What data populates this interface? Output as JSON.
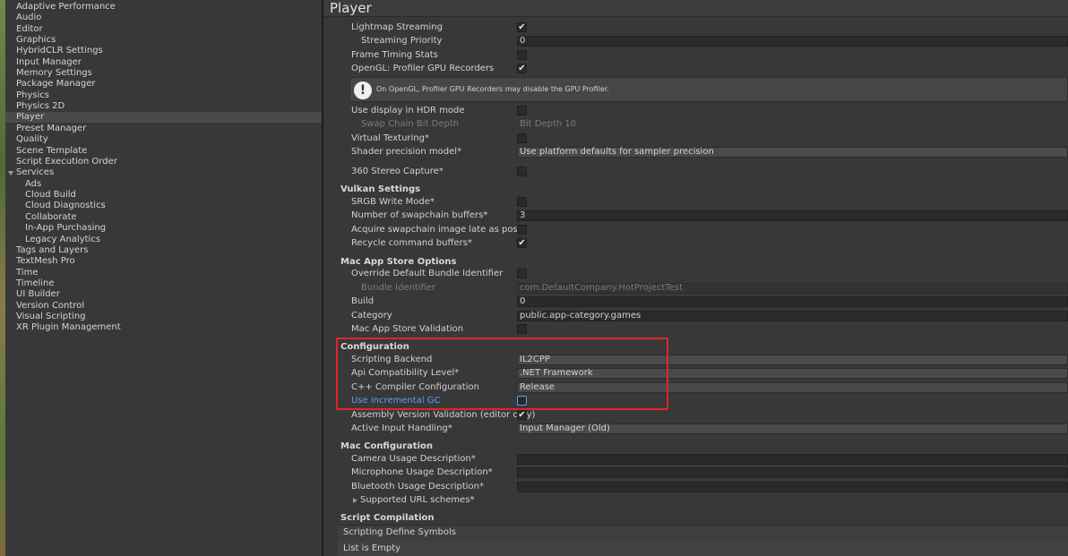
{
  "sidebar": {
    "items": [
      {
        "label": "Adaptive Performance"
      },
      {
        "label": "Audio"
      },
      {
        "label": "Editor"
      },
      {
        "label": "Graphics"
      },
      {
        "label": "HybridCLR Settings"
      },
      {
        "label": "Input Manager"
      },
      {
        "label": "Memory Settings"
      },
      {
        "label": "Package Manager"
      },
      {
        "label": "Physics"
      },
      {
        "label": "Physics 2D"
      },
      {
        "label": "Player",
        "selected": true
      },
      {
        "label": "Preset Manager"
      },
      {
        "label": "Quality"
      },
      {
        "label": "Scene Template"
      },
      {
        "label": "Script Execution Order"
      },
      {
        "label": "Services",
        "expanded": true
      },
      {
        "label": "Ads"
      },
      {
        "label": "Cloud Build"
      },
      {
        "label": "Cloud Diagnostics"
      },
      {
        "label": "Collaborate"
      },
      {
        "label": "In-App Purchasing"
      },
      {
        "label": "Legacy Analytics"
      },
      {
        "label": "Tags and Layers"
      },
      {
        "label": "TextMesh Pro"
      },
      {
        "label": "Time"
      },
      {
        "label": "Timeline"
      },
      {
        "label": "UI Builder"
      },
      {
        "label": "Version Control"
      },
      {
        "label": "Visual Scripting"
      },
      {
        "label": "XR Plugin Management"
      }
    ]
  },
  "main": {
    "title": "Player",
    "rows": {
      "lightmap_streaming": {
        "label": "Lightmap Streaming",
        "checked": true
      },
      "streaming_priority": {
        "label": "Streaming Priority",
        "value": "0"
      },
      "frame_timing_stats": {
        "label": "Frame Timing Stats",
        "checked": false
      },
      "opengl_profiler": {
        "label": "OpenGL: Profiler GPU Recorders",
        "checked": true
      },
      "use_display_hdr": {
        "label": "Use display in HDR mode",
        "checked": false
      },
      "swap_chain_bit_depth": {
        "label": "Swap Chain Bit Depth",
        "value": "Bit Depth 10"
      },
      "virtual_texturing": {
        "label": "Virtual Texturing*",
        "checked": false
      },
      "shader_precision": {
        "label": "Shader precision model*",
        "value": "Use platform defaults for sampler precision"
      },
      "stereo_capture": {
        "label": "360 Stereo Capture*",
        "checked": false
      },
      "srgb_write_mode": {
        "label": "SRGB Write Mode*",
        "checked": false
      },
      "swapchain_buffers": {
        "label": "Number of swapchain buffers*",
        "value": "3"
      },
      "acquire_swapchain": {
        "label": "Acquire swapchain image late as possible",
        "checked": false
      },
      "recycle_cmd_buffers": {
        "label": "Recycle command buffers*",
        "checked": true
      },
      "override_bundle_id": {
        "label": "Override Default Bundle Identifier",
        "checked": false
      },
      "bundle_identifier": {
        "label": "Bundle Identifier",
        "value": "com.DefaultCompany.HotProjectTest"
      },
      "build": {
        "label": "Build",
        "value": "0"
      },
      "category": {
        "label": "Category",
        "value": "public.app-category.games"
      },
      "mac_store_validation": {
        "label": "Mac App Store Validation",
        "checked": false
      },
      "scripting_backend": {
        "label": "Scripting Backend",
        "value": "IL2CPP"
      },
      "api_compat": {
        "label": "Api Compatibility Level*",
        "value": ".NET Framework"
      },
      "cpp_compiler": {
        "label": "C++ Compiler Configuration",
        "value": "Release"
      },
      "incremental_gc": {
        "label": "Use incremental GC",
        "checked": false
      },
      "assembly_validation": {
        "label": "Assembly Version Validation (editor only)",
        "checked": true
      },
      "active_input": {
        "label": "Active Input Handling*",
        "value": "Input Manager (Old)"
      },
      "camera_usage": {
        "label": "Camera Usage Description*",
        "value": ""
      },
      "microphone_usage": {
        "label": "Microphone Usage Description*",
        "value": ""
      },
      "bluetooth_usage": {
        "label": "Bluetooth Usage Description*",
        "value": ""
      },
      "supported_url_schemes": {
        "label": "Supported URL schemes*"
      }
    },
    "help_message": "On OpenGL, Profiler GPU Recorders may disable the GPU Profiler.",
    "sections": {
      "vulkan": "Vulkan Settings",
      "mac_app_store": "Mac App Store Options",
      "configuration": "Configuration",
      "mac_configuration": "Mac Configuration",
      "script_compilation": "Script Compilation"
    },
    "scripting_define_symbols": {
      "label": "Scripting Define Symbols",
      "empty_text": "List is Empty"
    },
    "annotation_color": "#e0262a"
  }
}
